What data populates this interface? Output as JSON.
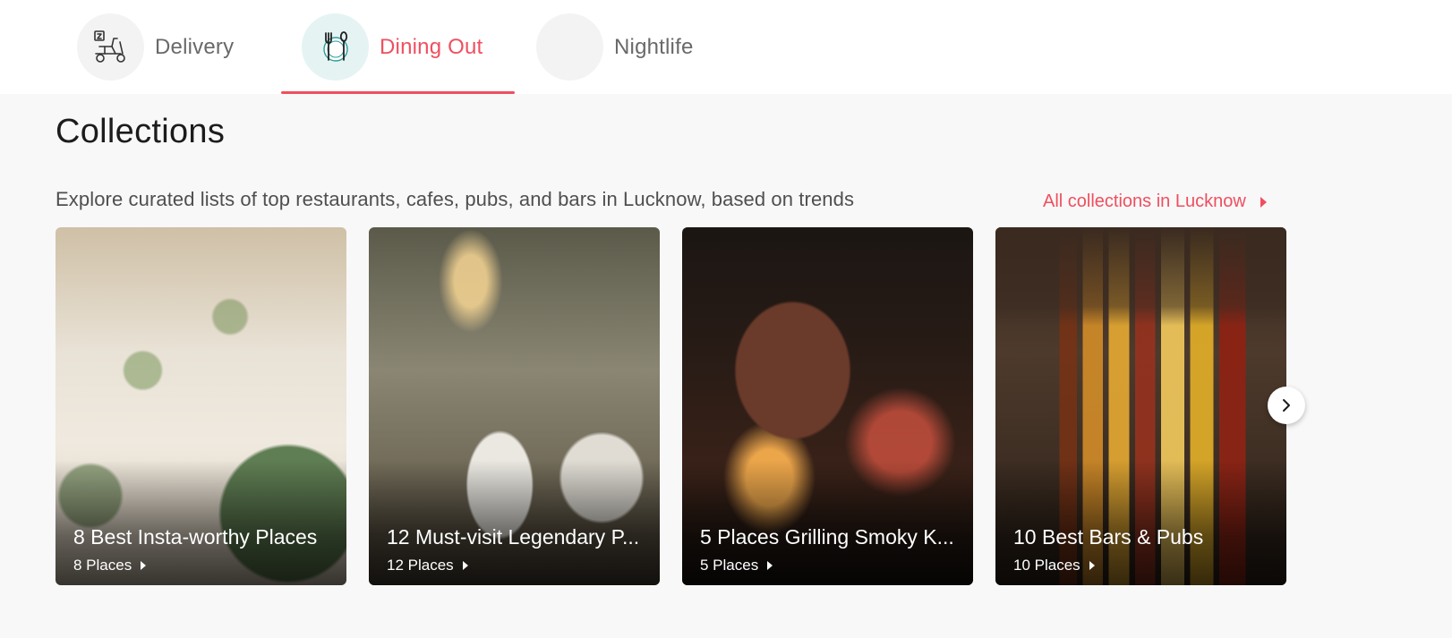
{
  "tabs": [
    {
      "label": "Delivery",
      "icon": "scooter-icon",
      "active": false
    },
    {
      "label": "Dining Out",
      "icon": "plate-cutlery-icon",
      "active": true
    },
    {
      "label": "Nightlife",
      "icon": "",
      "active": false
    }
  ],
  "section": {
    "title": "Collections",
    "subtitle": "Explore curated lists of top restaurants, cafes, pubs, and bars in Lucknow, based on trends",
    "all_link": "All collections in Lucknow"
  },
  "cards": [
    {
      "title": "8 Best Insta-worthy Places",
      "places": "8 Places"
    },
    {
      "title": "12 Must-visit Legendary P...",
      "places": "12 Places"
    },
    {
      "title": "5 Places Grilling Smoky K...",
      "places": "5 Places"
    },
    {
      "title": "10 Best Bars & Pubs",
      "places": "10 Places"
    }
  ],
  "colors": {
    "accent": "#ef4f5f",
    "active_tab_circle": "#e5f3f3",
    "page_bg": "#f8f8f8"
  }
}
